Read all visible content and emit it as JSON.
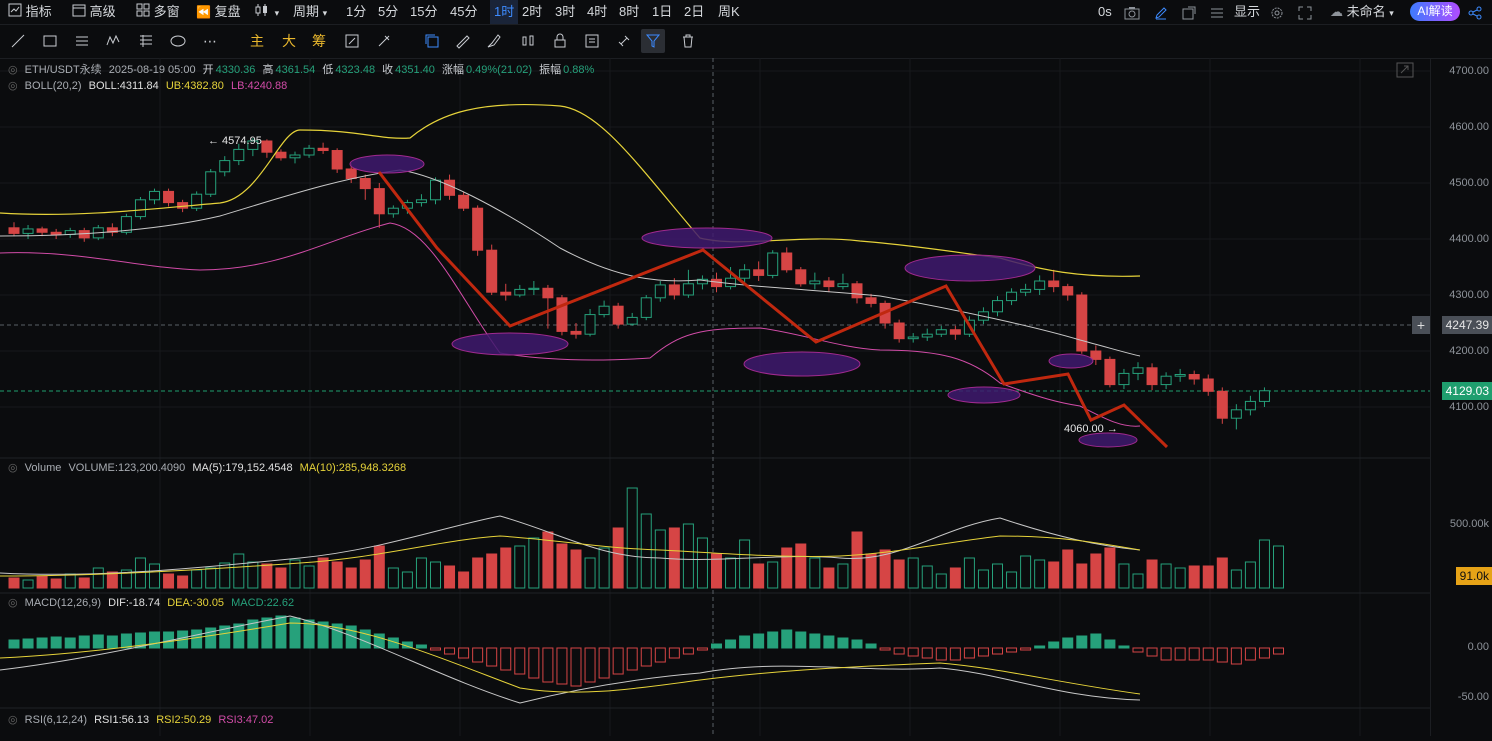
{
  "toolbar": {
    "indicators": "指标",
    "advanced": "高级",
    "multi_window": "多窗",
    "replay": "复盘",
    "period": "周期",
    "timeframes": [
      "1分",
      "5分",
      "15分",
      "45分",
      "1时",
      "2时",
      "3时",
      "4时",
      "8时",
      "1日",
      "2日",
      "周K"
    ],
    "active_timeframe": "1时",
    "seconds": "0s",
    "display": "显示",
    "unnamed": "未命名",
    "ai_button": "AI解读"
  },
  "drawing_tools": {
    "main": "主",
    "big": "大",
    "chips": "筹"
  },
  "price_legend": {
    "symbol": "ETH/USDT永续",
    "datetime": "2025-08-19 05:00",
    "open_label": "开",
    "open": "4330.36",
    "high_label": "高",
    "high": "4361.54",
    "low_label": "低",
    "low": "4323.48",
    "close_label": "收",
    "close": "4351.40",
    "change_label": "涨幅",
    "change": "0.49%(21.02)",
    "amp_label": "振幅",
    "amp": "0.88%"
  },
  "boll_legend": {
    "name": "BOLL(20,2)",
    "boll": "BOLL:4311.84",
    "ub": "UB:4382.80",
    "lb": "LB:4240.88"
  },
  "volume_legend": {
    "name": "Volume",
    "volume": "VOLUME:123,200.4090",
    "ma5": "MA(5):179,152.4548",
    "ma10": "MA(10):285,948.3268"
  },
  "macd_legend": {
    "name": "MACD(12,26,9)",
    "dif": "DIF:-18.74",
    "dea": "DEA:-30.05",
    "macd": "MACD:22.62"
  },
  "rsi_legend": {
    "name": "RSI(6,12,24)",
    "rsi1": "RSI1:56.13",
    "rsi2": "RSI2:50.29",
    "rsi3": "RSI3:47.02"
  },
  "price_axis": [
    "4700.00",
    "4600.00",
    "4500.00",
    "4400.00",
    "4300.00",
    "4200.00",
    "4100.00"
  ],
  "crosshair_price": "4247.39",
  "last_price": "4129.03",
  "volume_axis": "500.00k",
  "volume_tag": "91.0k",
  "macd_axis": [
    "0.00",
    "-50.00"
  ],
  "annotations": {
    "high": "4574.95",
    "low": "4060.00"
  },
  "colors": {
    "up": "#26a17b",
    "down": "#d64545",
    "ub": "#e6d33a",
    "mid": "#c7c7c7",
    "lb": "#d24ca8",
    "trend": "#c0280f",
    "ellipse": "#3f1a6e"
  }
}
